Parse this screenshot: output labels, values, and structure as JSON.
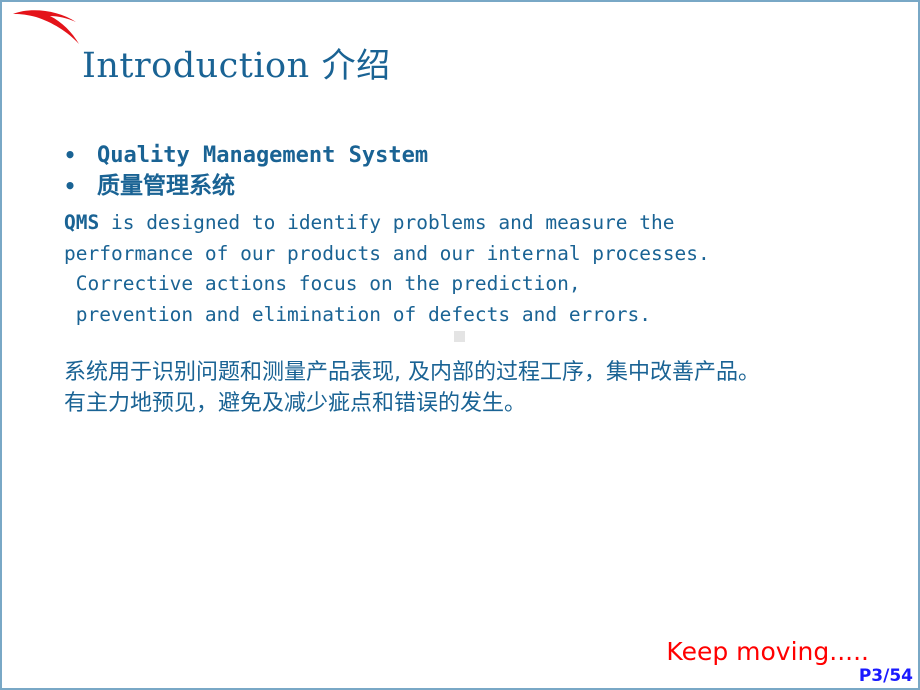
{
  "slide": {
    "background_color": "#ffffff",
    "border_color": "#79a8c6",
    "accent_blue": "#1a6394",
    "logo_red": "#e4131a",
    "footer_red": "#ff0000",
    "page_number_blue": "#1a1aff"
  },
  "logo": {
    "name": "anta-swoosh-logo",
    "color": "#e4131a"
  },
  "title": {
    "english": "Introduction",
    "chinese": "介绍"
  },
  "bullets": [
    {
      "mark": "•",
      "text": "Quality Management System",
      "lang": "en"
    },
    {
      "mark": "•",
      "text": "质量管理系统",
      "lang": "cn"
    }
  ],
  "paragraph_en": {
    "lead": "QMS",
    "rest": " is designed to identify problems and measure the\nperformance of our products and our internal processes.\n Corrective actions focus on the prediction,\n prevention and elimination of defects and errors."
  },
  "paragraph_cn": {
    "text": "系统用于识别问题和测量产品表现, 及内部的过程工序，集中改善产品。\n有主力地预见，避免及减少疵点和错误的发生。"
  },
  "footer": {
    "tagline": "Keep moving.....",
    "page_number": "P3/54"
  }
}
